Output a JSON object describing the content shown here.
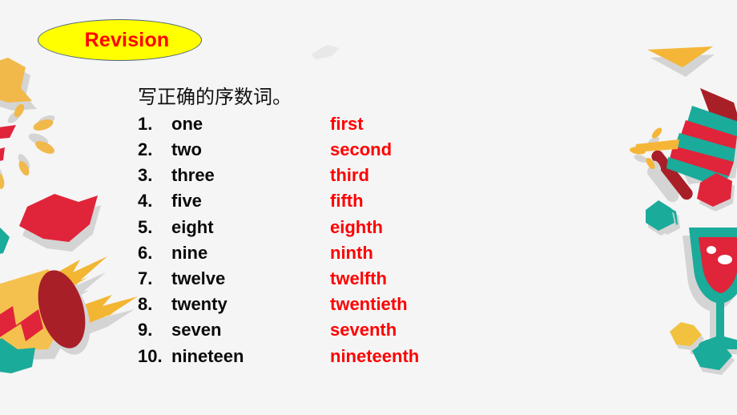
{
  "slide": {
    "background_color": "#f5f5f5",
    "title": {
      "text": "Revision",
      "text_color": "#ff0000",
      "fill_color": "#ffff00",
      "border_color": "#4a6480"
    },
    "instruction": "写正确的序数词。",
    "answer_color": "#ff0000",
    "word_color": "#0a0a0a",
    "items": [
      {
        "num": "1.",
        "word": "one",
        "answer": "first"
      },
      {
        "num": "2.",
        "word": "two",
        "answer": "second"
      },
      {
        "num": "3.",
        "word": "three",
        "answer": "third"
      },
      {
        "num": "4.",
        "word": "five",
        "answer": "fifth"
      },
      {
        "num": "5.",
        "word": "eight",
        "answer": "eighth"
      },
      {
        "num": "6.",
        "word": "nine",
        "answer": "ninth"
      },
      {
        "num": "7.",
        "word": "twelve",
        "answer": "twelfth"
      },
      {
        "num": "8.",
        "word": "twenty",
        "answer": "twentieth"
      },
      {
        "num": "9.",
        "word": "seven",
        "answer": "seventh"
      },
      {
        "num": "10.",
        "word": "nineteen",
        "answer": "nineteenth"
      }
    ],
    "decorations": {
      "palette": {
        "red": "#e0243a",
        "dark_red": "#a81f28",
        "teal": "#1aab9b",
        "yellow": "#f7b731",
        "amber": "#f5b942",
        "gold": "#f0c419",
        "shadow": "#d4d4d4"
      },
      "elements": [
        "amber-star-top-left",
        "confetti-burst-left",
        "red-star-left",
        "party-popper-drum",
        "teal-star-bottom-left",
        "faint-shape-top-center",
        "yellow-fan-top-right",
        "maraca-right",
        "red-star-right",
        "teal-star-right",
        "wine-glass-bottom-right",
        "teal-star-bottom-right",
        "gold-star-bottom-right"
      ]
    }
  }
}
